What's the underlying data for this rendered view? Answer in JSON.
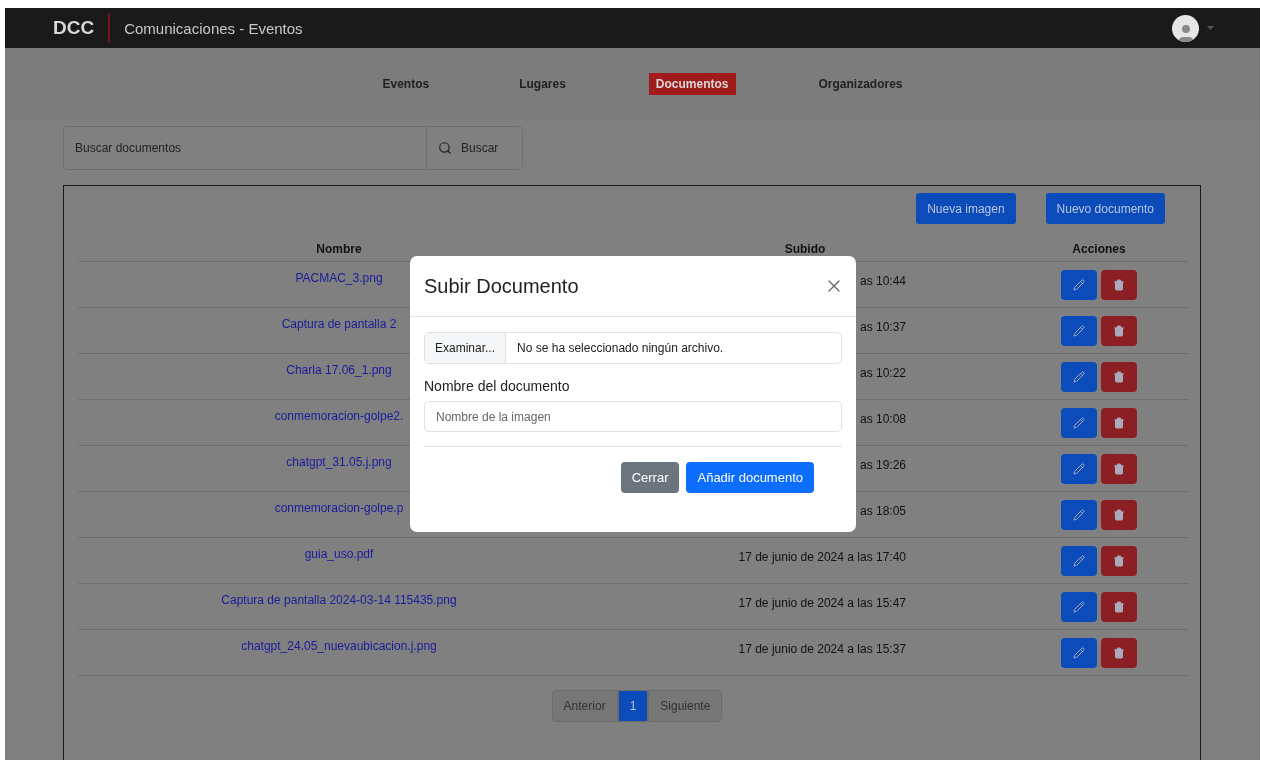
{
  "navbar": {
    "brand": "DCC",
    "title": "Comunicaciones - Eventos"
  },
  "nav": [
    {
      "label": "Eventos",
      "selected": false
    },
    {
      "label": "Lugares",
      "selected": false
    },
    {
      "label": "Documentos",
      "selected": true
    },
    {
      "label": "Organizadores",
      "selected": false
    }
  ],
  "search": {
    "placeholder": "Buscar documentos",
    "button": "Buscar"
  },
  "toolbar": [
    "Nueva imagen",
    "Nuevo documento"
  ],
  "table": {
    "columns": [
      "Nombre",
      "Subido",
      "Acciones"
    ],
    "rows": [
      {
        "name": "PACMAC_3.png",
        "uploaded": "as 10:44"
      },
      {
        "name": "Captura de pantalla 2",
        "uploaded": "as 10:37"
      },
      {
        "name": "Charla 17.06_1.png",
        "uploaded": "as 10:22"
      },
      {
        "name": "conmemoracion-golpe2.",
        "uploaded": "as 10:08"
      },
      {
        "name": "chatgpt_31.05.j.png",
        "uploaded": "as 19:26"
      },
      {
        "name": "conmemoracion-golpe.p",
        "uploaded": "as 18:05"
      },
      {
        "name": "guia_uso.pdf",
        "uploaded": "17 de junio de 2024 a las 17:40"
      },
      {
        "name": "Captura de pantalla 2024-03-14 115435.png",
        "uploaded": "17 de junio de 2024 a las 15:47"
      },
      {
        "name": "chatgpt_24.05_nuevaubicacion.j.png",
        "uploaded": "17 de junio de 2024 a las 15:37"
      }
    ]
  },
  "pagination": [
    {
      "label": "Anterior",
      "selected": false
    },
    {
      "label": "1",
      "selected": true
    },
    {
      "label": "Siguiente",
      "selected": false
    }
  ],
  "modal": {
    "title": "Subir Documento",
    "file_button": "Examinar...",
    "file_status": "No se ha seleccionado ningún archivo.",
    "label": "Nombre del documento",
    "placeholder": "Nombre de la imagen",
    "buttons": [
      {
        "label": "Cerrar",
        "kind": "secondary"
      },
      {
        "label": "Añadir documento",
        "kind": "primary"
      }
    ]
  }
}
